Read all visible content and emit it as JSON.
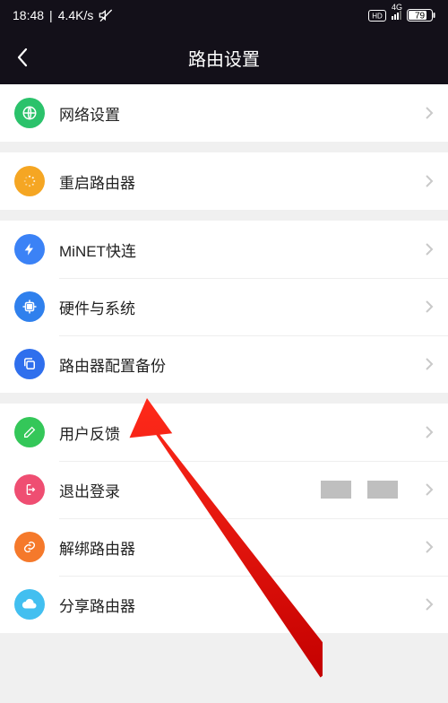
{
  "status": {
    "time": "18:48",
    "speed": "4.4K/s",
    "network": "4G",
    "battery": "79"
  },
  "nav": {
    "title": "路由设置"
  },
  "rows": {
    "network": "网络设置",
    "restart": "重启路由器",
    "minet": "MiNET快连",
    "hardware": "硬件与系统",
    "backup": "路由器配置备份",
    "feedback": "用户反馈",
    "logout": "退出登录",
    "unbind": "解绑路由器",
    "share": "分享路由器"
  }
}
